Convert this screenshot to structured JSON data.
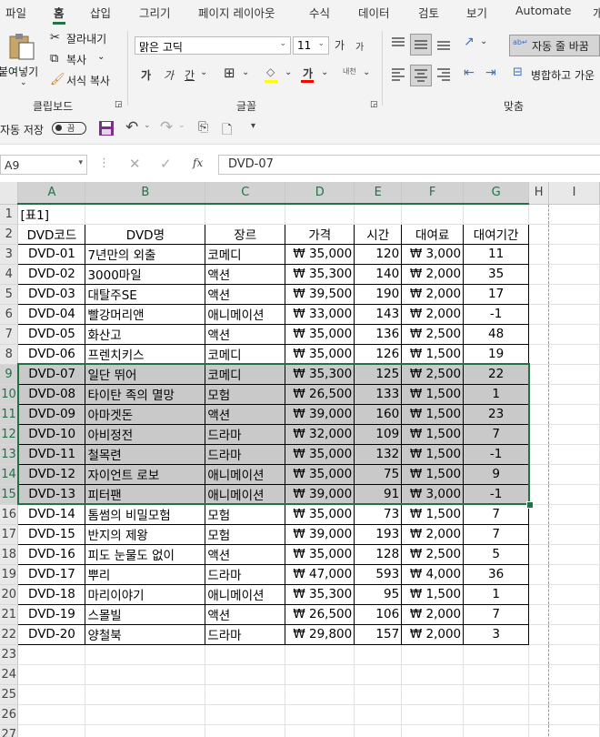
{
  "menu": {
    "tabs": [
      {
        "label": "파일"
      },
      {
        "label": "홈",
        "active": true
      },
      {
        "label": "삽입"
      },
      {
        "label": "그리기"
      },
      {
        "label": "페이지 레이아웃"
      },
      {
        "label": "수식"
      },
      {
        "label": "데이터"
      },
      {
        "label": "검토"
      },
      {
        "label": "보기"
      },
      {
        "label": "Automate"
      },
      {
        "label": "개"
      }
    ]
  },
  "ribbon": {
    "clipboard": {
      "paste_label": "붙여넣기",
      "cut_label": "잘라내기",
      "copy_label": "복사",
      "format_painter_label": "서식 복사",
      "group_label": "클립보드"
    },
    "font": {
      "font_name": "맑은 고딕",
      "font_size": "11",
      "grow_glyph": "가",
      "shrink_glyph": "가",
      "bold_glyph": "가",
      "italic_glyph": "가",
      "underline_glyph": "간",
      "fill_glyph": "◇",
      "font_color_glyph": "가",
      "phonetic_glyph": "내천",
      "group_label": "글꼴"
    },
    "alignment": {
      "wrap_text_label": "자동 줄 바꿈",
      "merge_label": "병합하고 가운",
      "group_label": "맞춤"
    }
  },
  "qat": {
    "autosave_label": "자동 저장",
    "toggle_state": "끔"
  },
  "formula_bar": {
    "name_box": "A9",
    "fx_label": "fx",
    "content": "DVD-07"
  },
  "sheet": {
    "columns": [
      "A",
      "B",
      "C",
      "D",
      "E",
      "F",
      "G",
      "H",
      "I"
    ],
    "selected_columns": [
      "A",
      "B",
      "C",
      "D",
      "E",
      "F",
      "G"
    ],
    "selected_rows": [
      9,
      10,
      11,
      12,
      13,
      14,
      15
    ],
    "title": "[표1]",
    "headers": [
      "DVD코드",
      "DVD명",
      "장르",
      "가격",
      "시간",
      "대여료",
      "대여기간"
    ],
    "rows": [
      [
        "DVD-01",
        "7년만의 외출",
        "코메디",
        "₩ 35,000",
        "120",
        "₩ 3,000",
        "11"
      ],
      [
        "DVD-02",
        "3000마일",
        "액션",
        "₩ 35,300",
        "140",
        "₩ 2,000",
        "35"
      ],
      [
        "DVD-03",
        "대탈주SE",
        "액션",
        "₩ 39,500",
        "190",
        "₩ 2,000",
        "17"
      ],
      [
        "DVD-04",
        "빨강머리앤",
        "애니메이션",
        "₩ 33,000",
        "143",
        "₩ 2,000",
        "-1"
      ],
      [
        "DVD-05",
        "화산고",
        "액션",
        "₩ 35,000",
        "136",
        "₩ 2,500",
        "48"
      ],
      [
        "DVD-06",
        "프렌치키스",
        "코메디",
        "₩ 35,000",
        "126",
        "₩ 1,500",
        "19"
      ],
      [
        "DVD-07",
        "일단 뛰어",
        "코메디",
        "₩ 35,300",
        "125",
        "₩ 2,500",
        "22"
      ],
      [
        "DVD-08",
        "타이탄 족의 멸망",
        "모험",
        "₩ 26,500",
        "133",
        "₩ 1,500",
        "1"
      ],
      [
        "DVD-09",
        "아마겟돈",
        "액션",
        "₩ 39,000",
        "160",
        "₩ 1,500",
        "23"
      ],
      [
        "DVD-10",
        "아비정전",
        "드라마",
        "₩ 32,000",
        "109",
        "₩ 1,500",
        "7"
      ],
      [
        "DVD-11",
        "철목련",
        "드라마",
        "₩ 35,000",
        "132",
        "₩ 1,500",
        "-1"
      ],
      [
        "DVD-12",
        "자이언트 로보",
        "애니메이션",
        "₩ 35,000",
        "75",
        "₩ 1,500",
        "9"
      ],
      [
        "DVD-13",
        "피터팬",
        "애니메이션",
        "₩ 39,000",
        "91",
        "₩ 3,000",
        "-1"
      ],
      [
        "DVD-14",
        "톰썸의 비밀모험",
        "모험",
        "₩ 35,000",
        "73",
        "₩ 1,500",
        "7"
      ],
      [
        "DVD-15",
        "반지의 제왕",
        "모험",
        "₩ 39,000",
        "193",
        "₩ 2,000",
        "7"
      ],
      [
        "DVD-16",
        "피도 눈물도 없이",
        "액션",
        "₩ 35,000",
        "128",
        "₩ 2,500",
        "5"
      ],
      [
        "DVD-17",
        "뿌리",
        "드라마",
        "₩ 47,000",
        "593",
        "₩ 4,000",
        "36"
      ],
      [
        "DVD-18",
        "마리이야기",
        "애니메이션",
        "₩ 35,300",
        "95",
        "₩ 1,500",
        "1"
      ],
      [
        "DVD-19",
        "스몰빌",
        "액션",
        "₩ 26,500",
        "106",
        "₩ 2,000",
        "7"
      ],
      [
        "DVD-20",
        "양철북",
        "드라마",
        "₩ 29,800",
        "157",
        "₩ 2,000",
        "3"
      ]
    ],
    "row_numbers": [
      1,
      2,
      3,
      4,
      5,
      6,
      7,
      8,
      9,
      10,
      11,
      12,
      13,
      14,
      15,
      16,
      17,
      18,
      19,
      20,
      21,
      22,
      23,
      24,
      25,
      26,
      27
    ],
    "colors": {
      "accent": "#217346",
      "selection_fill": "#c9c9c9"
    }
  }
}
